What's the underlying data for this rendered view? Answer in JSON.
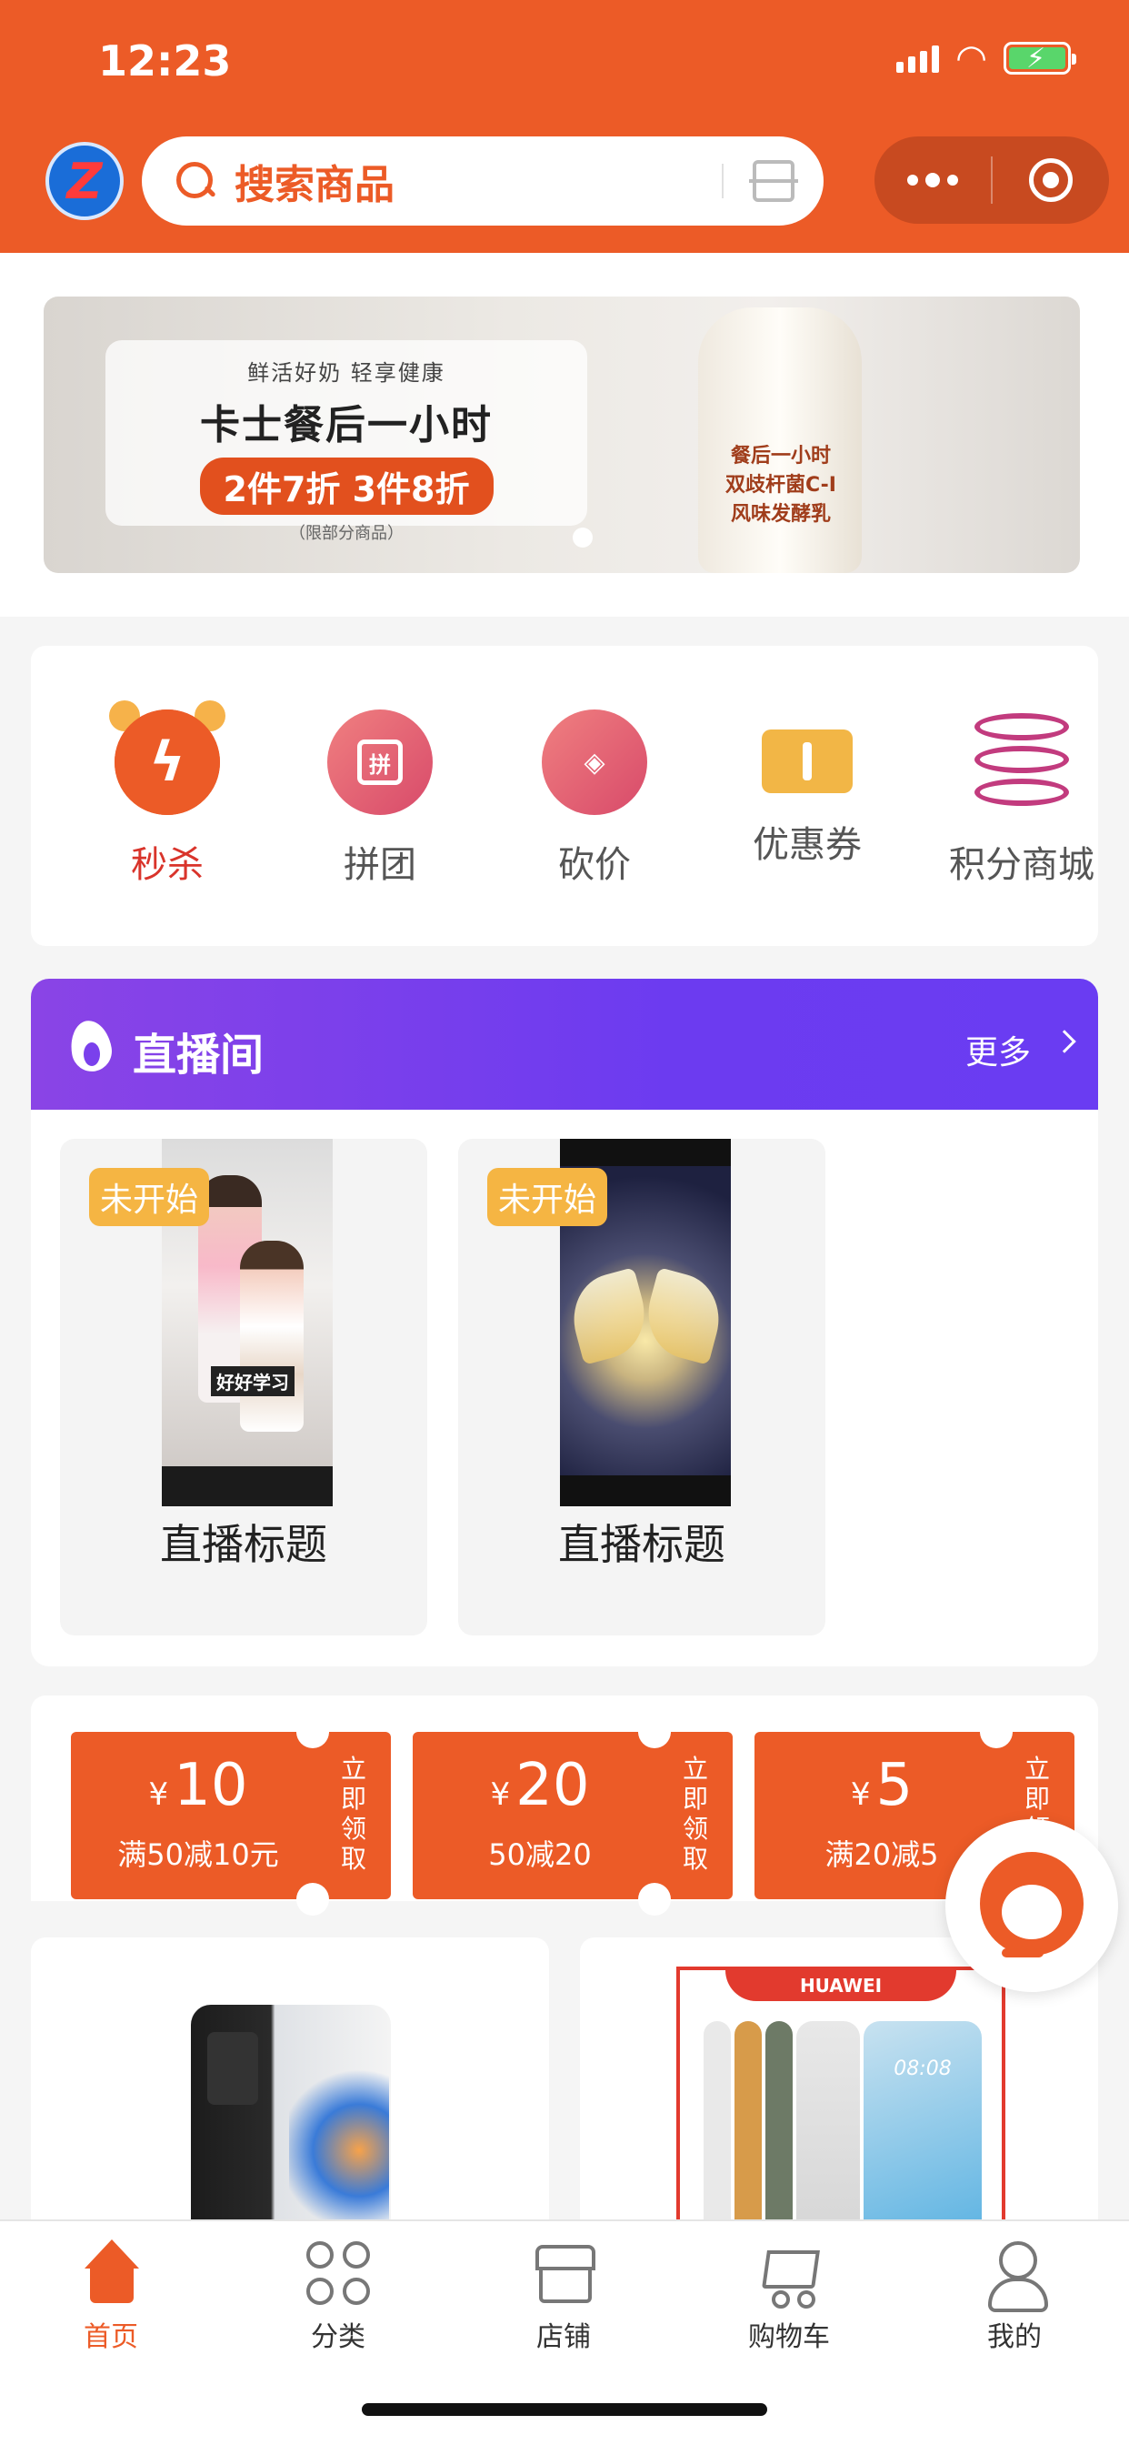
{
  "status_bar": {
    "time": "12:23"
  },
  "header": {
    "logo_letter": "Z",
    "search_placeholder": "搜索商品",
    "icons": [
      "search-icon",
      "scan-icon",
      "more-icon",
      "target-icon"
    ]
  },
  "banner": {
    "tagline": "鲜活好奶 轻享健康",
    "title": "卡士餐后一小时",
    "promo": "2件7折 3件8折",
    "note": "（限部分商品）",
    "bottle_text": "餐后一小时\n双歧杆菌C-I\n风味发酵乳"
  },
  "menu": {
    "items": [
      {
        "label": "秒杀",
        "icon": "alarm-clock-icon",
        "color": "#d9342b"
      },
      {
        "label": "拼团",
        "icon": "shopping-bag-icon",
        "glyph": "拼"
      },
      {
        "label": "砍价",
        "icon": "price-tag-icon"
      },
      {
        "label": "优惠券",
        "icon": "ticket-icon"
      },
      {
        "label": "积分商城",
        "icon": "coin-stack-icon"
      }
    ]
  },
  "live": {
    "title": "直播间",
    "more": "更多",
    "items": [
      {
        "badge": "未开始",
        "name": "直播标题",
        "caption": "好好学习"
      },
      {
        "badge": "未开始",
        "name": "直播标题"
      }
    ]
  },
  "coupons": [
    {
      "currency": "¥",
      "amount": "10",
      "condition": "满50减10元",
      "claim": "立即领取"
    },
    {
      "currency": "¥",
      "amount": "20",
      "condition": "50减20",
      "claim": "立即领取"
    },
    {
      "currency": "¥",
      "amount": "5",
      "condition": "满20减5",
      "claim": "立即领取"
    }
  ],
  "products": [
    {
      "image": "phone-black-product"
    },
    {
      "image": "huawei-phone-box",
      "brand": "HUAWEI",
      "screen_time": "08:08"
    }
  ],
  "tabbar": {
    "items": [
      {
        "label": "首页",
        "icon": "home-icon",
        "active": true
      },
      {
        "label": "分类",
        "icon": "category-grid-icon"
      },
      {
        "label": "店铺",
        "icon": "store-icon"
      },
      {
        "label": "购物车",
        "icon": "cart-icon"
      },
      {
        "label": "我的",
        "icon": "user-icon"
      }
    ]
  },
  "colors": {
    "accent": "#ec5b27",
    "live_header": "#6c3bf0",
    "badge": "#f5b543"
  }
}
